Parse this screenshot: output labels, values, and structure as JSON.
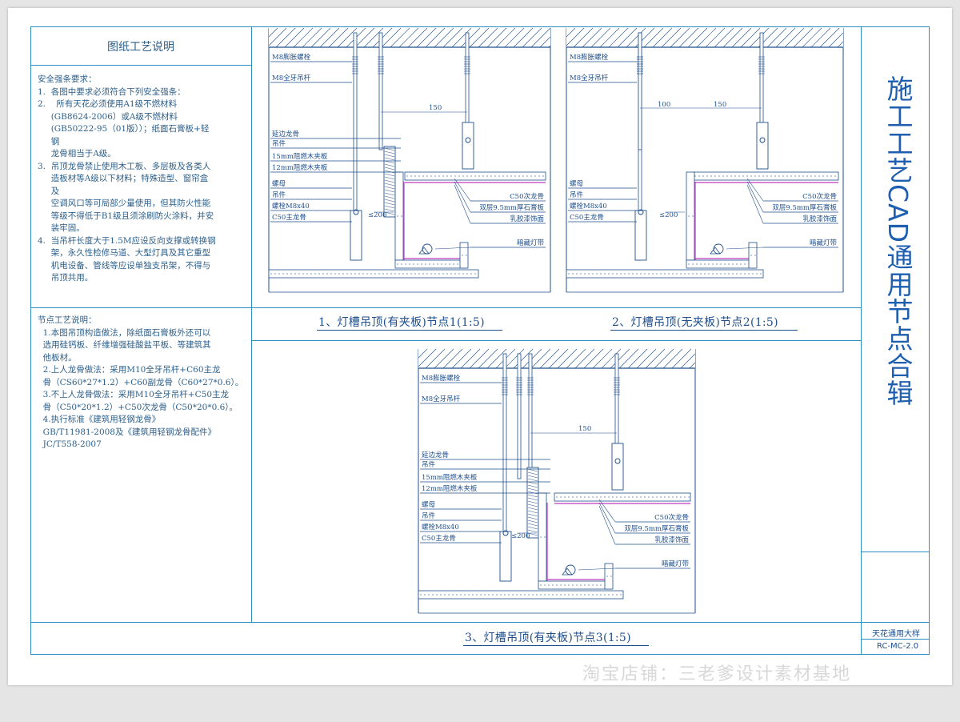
{
  "left_panel": {
    "title": "图纸工艺说明",
    "safety_lines": [
      "安全强条要求：",
      "1.  各图中要求必须符合下列安全强条：",
      "2.    所有天花必须使用A1级不燃材料",
      "     (GB8624-2006）或A级不燃材料",
      "     (GB50222-95（01版））；纸面石膏板+轻",
      "     钢",
      "     龙骨相当于A级。",
      "3.  吊顶龙骨禁止使用木工板、多层板及各类人",
      "     造板材等A级以下材料；特殊造型、窗帘盒",
      "     及",
      "     空调风口等可局部少量使用，但其防火性能",
      "     等级不得低于B1级且须涂刷防火涂料，并安",
      "     装牢固。",
      "4.  当吊杆长度大于1.5M应设反向支撑或转换钢",
      "     架，永久性检修马道、大型灯具及其它重型",
      "     机电设备、管线等应设单独支吊架，不得与",
      "     吊顶共用。"
    ],
    "node_lines": [
      "节点工艺说明：",
      "  1.本图吊顶构造做法，除纸面石膏板外还可以",
      "  选用硅钙板、纤维增强硅酸盐平板、等建筑其",
      "  他板材。",
      "  2.上人龙骨做法：采用M10全牙吊杆+C60主龙",
      "  骨（CS60*27*1.2）+C60副龙骨（C60*27*0.6）。",
      "  3.不上人龙骨做法：采用M10全牙吊杆+C50主龙",
      "  骨（C50*20*1.2）+C50次龙骨（C50*20*0.6）。",
      "  4.执行标准《建筑用轻钢龙骨》",
      "  GB/T11981-2008及《建筑用轻钢龙骨配件》",
      "  JC/T558-2007"
    ]
  },
  "drawings": {
    "d1": {
      "caption": "1、灯槽吊顶(有夹板)节点1(1:5)",
      "labels_left": [
        "M8膨胀螺栓",
        "M8全牙吊杆",
        "延边龙骨",
        "吊件",
        "15mm阻燃木夹板",
        "12mm阻燃木夹板",
        "螺母",
        "吊件",
        "螺栓M8x40",
        "C50主龙骨"
      ],
      "labels_right": [
        "C50次龙骨",
        "双层9.5mm厚石膏板",
        "乳胶漆饰面",
        "暗藏灯带"
      ],
      "dims": [
        "150",
        "≤200"
      ]
    },
    "d2": {
      "caption": "2、灯槽吊顶(无夹板)节点2(1:5)",
      "labels_left": [
        "M8膨胀螺栓",
        "M8全牙吊杆",
        "螺母",
        "吊件",
        "螺栓M8x40",
        "C50主龙骨"
      ],
      "labels_right": [
        "C50次龙骨",
        "双层9.5mm厚石膏板",
        "乳胶漆饰面",
        "暗藏灯带"
      ],
      "dims": [
        "100",
        "150",
        "≤200"
      ]
    },
    "d3": {
      "caption": "3、灯槽吊顶(有夹板)节点3(1:5)",
      "labels_left": [
        "M8膨胀螺栓",
        "M8全牙吊杆",
        "延边龙骨",
        "吊件",
        "15mm阻燃木夹板",
        "12mm阻燃木夹板",
        "螺母",
        "吊件",
        "螺栓M8x40",
        "C50主龙骨"
      ],
      "labels_right": [
        "C50次龙骨",
        "双层9.5mm厚石膏板",
        "乳胶漆饰面",
        "暗藏灯带"
      ],
      "dims": [
        "150",
        "≤200"
      ]
    }
  },
  "title_block": {
    "main_title": "施工工艺CAD通用节点合辑",
    "sheet_name": "天花通用大样",
    "sheet_code": "RC-MC-2.0"
  },
  "watermark": "淘宝店铺：三老爹设计素材基地",
  "colors": {
    "frame": "#2c8ec0",
    "text": "#2c5f8a",
    "drawing": "#1f4f8c",
    "accent_magenta": "#c03cc0"
  }
}
